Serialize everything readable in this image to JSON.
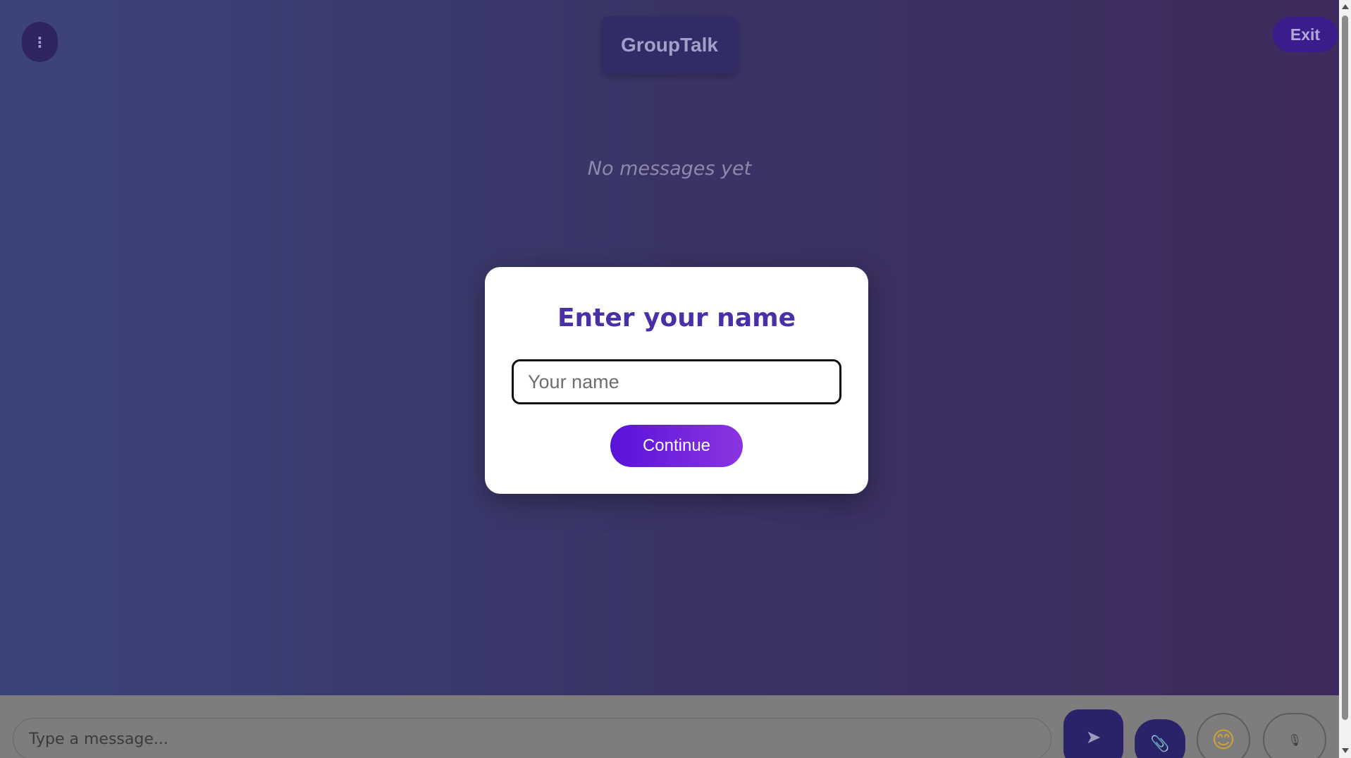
{
  "header": {
    "title": "GroupTalk",
    "exit_label": "Exit",
    "menu_icon": "⋮"
  },
  "main": {
    "empty_text": "No messages yet"
  },
  "modal": {
    "title": "Enter your name",
    "name_placeholder": "Your name",
    "name_value": "",
    "continue_label": "Continue"
  },
  "composer": {
    "message_placeholder": "Type a message...",
    "send_icon": "➤",
    "attach_icon": "📎",
    "emoji_icon": "😊",
    "mic_icon": "🎙"
  },
  "colors": {
    "accent": "#5a12d9",
    "title_text": "#4a30a6"
  }
}
